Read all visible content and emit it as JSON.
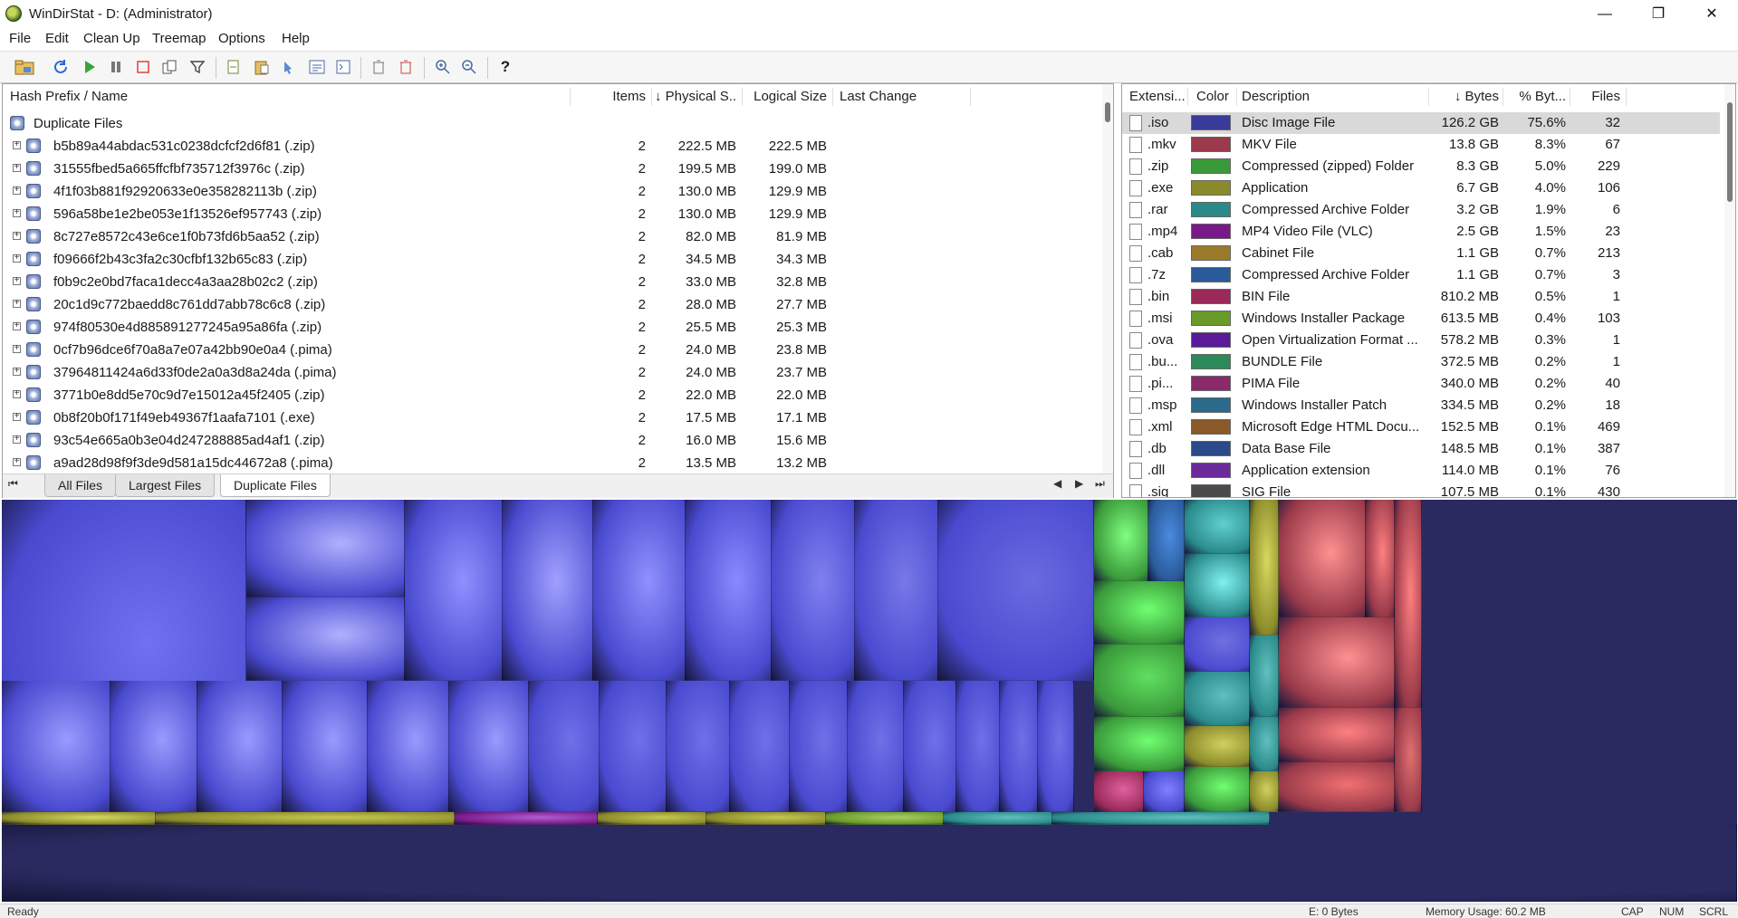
{
  "window": {
    "title": "WinDirStat - D: (Administrator)",
    "controls": {
      "minimize": "—",
      "restore": "❐",
      "close": "✕"
    }
  },
  "menu": [
    "File",
    "Edit",
    "Clean Up",
    "Treemap",
    "Options",
    "Help"
  ],
  "toolbar": {
    "icons": [
      "open-folder-icon",
      "refresh-icon",
      "play-icon",
      "pause-icon",
      "stop-icon",
      "copy-path-icon",
      "filter-icon",
      "open-item-icon",
      "paste-icon",
      "explore-icon",
      "properties-icon",
      "command-prompt-icon",
      "delete-to-bin-icon",
      "delete-icon",
      "zoom-in-icon",
      "zoom-out-icon",
      "help-icon"
    ],
    "help_label": "?"
  },
  "left_pane": {
    "columns": [
      "Hash Prefix / Name",
      "Items",
      "↓ Physical S...",
      "Logical Size",
      "Last Change"
    ],
    "root_label": "Duplicate Files",
    "rows": [
      {
        "name": "b5b89a44abdac531c0238dcfcf2d6f81 (.zip)",
        "items": "2",
        "physical": "222.5 MB",
        "logical": "222.5 MB"
      },
      {
        "name": "31555fbed5a665ffcfbf735712f3976c (.zip)",
        "items": "2",
        "physical": "199.5 MB",
        "logical": "199.0 MB"
      },
      {
        "name": "4f1f03b881f92920633e0e358282113b (.zip)",
        "items": "2",
        "physical": "130.0 MB",
        "logical": "129.9 MB"
      },
      {
        "name": "596a58be1e2be053e1f13526ef957743 (.zip)",
        "items": "2",
        "physical": "130.0 MB",
        "logical": "129.9 MB"
      },
      {
        "name": "8c727e8572c43e6ce1f0b73fd6b5aa52 (.zip)",
        "items": "2",
        "physical": "82.0 MB",
        "logical": "81.9 MB"
      },
      {
        "name": "f09666f2b43c3fa2c30cfbf132b65c83 (.zip)",
        "items": "2",
        "physical": "34.5 MB",
        "logical": "34.3 MB"
      },
      {
        "name": "f0b9c2e0bd7faca1decc4a3aa28b02c2 (.zip)",
        "items": "2",
        "physical": "33.0 MB",
        "logical": "32.8 MB"
      },
      {
        "name": "20c1d9c772baedd8c761dd7abb78c6c8 (.zip)",
        "items": "2",
        "physical": "28.0 MB",
        "logical": "27.7 MB"
      },
      {
        "name": "974f80530e4d885891277245a95a86fa (.zip)",
        "items": "2",
        "physical": "25.5 MB",
        "logical": "25.3 MB"
      },
      {
        "name": "0cf7b96dce6f70a8a7e07a42bb90e0a4 (.pima)",
        "items": "2",
        "physical": "24.0 MB",
        "logical": "23.8 MB"
      },
      {
        "name": "37964811424a6d33f0de2a0a3d8a24da (.pima)",
        "items": "2",
        "physical": "24.0 MB",
        "logical": "23.7 MB"
      },
      {
        "name": "3771b0e8dd5e70c9d7e15012a45f2405 (.zip)",
        "items": "2",
        "physical": "22.0 MB",
        "logical": "22.0 MB"
      },
      {
        "name": "0b8f20b0f171f49eb49367f1aafa7101 (.exe)",
        "items": "2",
        "physical": "17.5 MB",
        "logical": "17.1 MB"
      },
      {
        "name": "93c54e665a0b3e04d247288885ad4af1 (.zip)",
        "items": "2",
        "physical": "16.0 MB",
        "logical": "15.6 MB"
      },
      {
        "name": "a9ad28d98f9f3de9d581a15dc44672a8 (.pima)",
        "items": "2",
        "physical": "13.5 MB",
        "logical": "13.2 MB"
      }
    ],
    "tabs": [
      "All Files",
      "Largest Files",
      "Duplicate Files"
    ],
    "nav": {
      "first": "⏮",
      "prev": "◀",
      "next": "▶",
      "last": "⏭"
    }
  },
  "right_pane": {
    "columns": [
      "Extensi...",
      "Color",
      "Description",
      "↓ Bytes",
      "% Byt...",
      "Files"
    ],
    "rows": [
      {
        "ext": ".iso",
        "color": "#3a3a9a",
        "desc": "Disc Image File",
        "bytes": "126.2 GB",
        "pct": "75.6%",
        "files": "32"
      },
      {
        "ext": ".mkv",
        "color": "#9a3a4a",
        "desc": "MKV File",
        "bytes": "13.8 GB",
        "pct": "8.3%",
        "files": "67"
      },
      {
        "ext": ".zip",
        "color": "#3a9a3a",
        "desc": "Compressed (zipped) Folder",
        "bytes": "8.3 GB",
        "pct": "5.0%",
        "files": "229"
      },
      {
        "ext": ".exe",
        "color": "#8a8a2a",
        "desc": "Application",
        "bytes": "6.7 GB",
        "pct": "4.0%",
        "files": "106"
      },
      {
        "ext": ".rar",
        "color": "#2a8a8a",
        "desc": "Compressed Archive Folder",
        "bytes": "3.2 GB",
        "pct": "1.9%",
        "files": "6"
      },
      {
        "ext": ".mp4",
        "color": "#7a1a8a",
        "desc": "MP4 Video File (VLC)",
        "bytes": "2.5 GB",
        "pct": "1.5%",
        "files": "23"
      },
      {
        "ext": ".cab",
        "color": "#9a7a2a",
        "desc": "Cabinet File",
        "bytes": "1.1 GB",
        "pct": "0.7%",
        "files": "213"
      },
      {
        "ext": ".7z",
        "color": "#2a5a9a",
        "desc": "Compressed Archive Folder",
        "bytes": "1.1 GB",
        "pct": "0.7%",
        "files": "3"
      },
      {
        "ext": ".bin",
        "color": "#9a2a5a",
        "desc": "BIN File",
        "bytes": "810.2 MB",
        "pct": "0.5%",
        "files": "1"
      },
      {
        "ext": ".msi",
        "color": "#6a9a2a",
        "desc": "Windows Installer Package",
        "bytes": "613.5 MB",
        "pct": "0.4%",
        "files": "103"
      },
      {
        "ext": ".ova",
        "color": "#5a1a9a",
        "desc": "Open Virtualization Format ...",
        "bytes": "578.2 MB",
        "pct": "0.3%",
        "files": "1"
      },
      {
        "ext": ".bu...",
        "color": "#2a8a5a",
        "desc": "BUNDLE File",
        "bytes": "372.5 MB",
        "pct": "0.2%",
        "files": "1"
      },
      {
        "ext": ".pi...",
        "color": "#8a2a6a",
        "desc": "PIMA File",
        "bytes": "340.0 MB",
        "pct": "0.2%",
        "files": "40"
      },
      {
        "ext": ".msp",
        "color": "#2a6a8a",
        "desc": "Windows Installer Patch",
        "bytes": "334.5 MB",
        "pct": "0.2%",
        "files": "18"
      },
      {
        "ext": ".xml",
        "color": "#8a5a2a",
        "desc": "Microsoft Edge HTML Docu...",
        "bytes": "152.5 MB",
        "pct": "0.1%",
        "files": "469"
      },
      {
        "ext": ".db",
        "color": "#2a4a8a",
        "desc": "Data Base File",
        "bytes": "148.5 MB",
        "pct": "0.1%",
        "files": "387"
      },
      {
        "ext": ".dll",
        "color": "#6a2a9a",
        "desc": "Application extension",
        "bytes": "114.0 MB",
        "pct": "0.1%",
        "files": "76"
      },
      {
        "ext": ".sig",
        "color": "#4a4a4a",
        "desc": "SIG File",
        "bytes": "107.5 MB",
        "pct": "0.1%",
        "files": "430"
      }
    ]
  },
  "status_bar": {
    "left": "Ready",
    "size": "E: 0 Bytes",
    "memory": "Memory Usage: 60.2 MB",
    "cap": "CAP",
    "num": "NUM",
    "scrl": "SCRL"
  }
}
